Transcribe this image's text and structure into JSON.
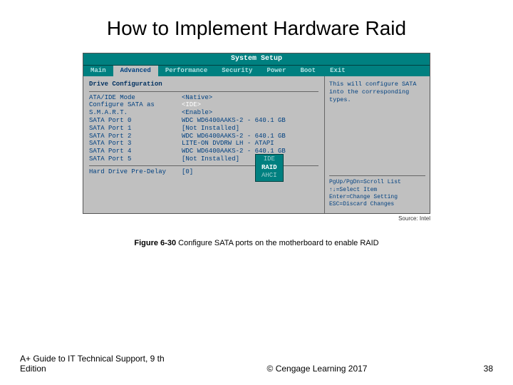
{
  "title": "How to Implement Hardware Raid",
  "bios": {
    "header": "System Setup",
    "tabs": [
      "Main",
      "Advanced",
      "Performance",
      "Security",
      "Power",
      "Boot",
      "Exit"
    ],
    "active_tab": 1,
    "section": "Drive Configuration",
    "rows": [
      {
        "label": "ATA/IDE Mode",
        "value": "<Native>"
      },
      {
        "label": "Configure SATA as",
        "value": "<IDE>",
        "highlight": true
      },
      {
        "label": "S.M.A.R.T.",
        "value": "<Enable>"
      },
      {
        "label": "SATA Port 0",
        "value": "WDC WD6400AAKS-2 - 640.1 GB"
      },
      {
        "label": "SATA Port 1",
        "value": "[Not Installed]"
      },
      {
        "label": "SATA Port 2",
        "value": "WDC WD6400AAKS-2 - 640.1 GB"
      },
      {
        "label": "SATA Port 3",
        "value": "LITE-ON DVDRW LH - ATAPI"
      },
      {
        "label": "SATA Port 4",
        "value": "WDC WD6400AAKS-2 - 640.1 GB"
      },
      {
        "label": "SATA Port 5",
        "value": "[Not Installed]"
      }
    ],
    "bottom_row": {
      "label": "Hard Drive Pre-Delay",
      "value": "[0]"
    },
    "dropdown": {
      "options": [
        "IDE",
        "RAID",
        "AHCI"
      ],
      "selected": 1
    },
    "help": "This will configure SATA into the corresponding types.",
    "keys": [
      "PgUp/PgDn=Scroll List",
      "↑↓=Select Item",
      "Enter=Change Setting",
      "ESC=Discard Changes"
    ]
  },
  "source_credit": "Source: Intel",
  "caption_bold": "Figure 6-30",
  "caption_rest": " Configure SATA ports on the motherboard to enable RAID",
  "footer": {
    "left": "A+ Guide to IT Technical Support, 9 th Edition",
    "center": "© Cengage Learning  2017",
    "page": "38"
  }
}
